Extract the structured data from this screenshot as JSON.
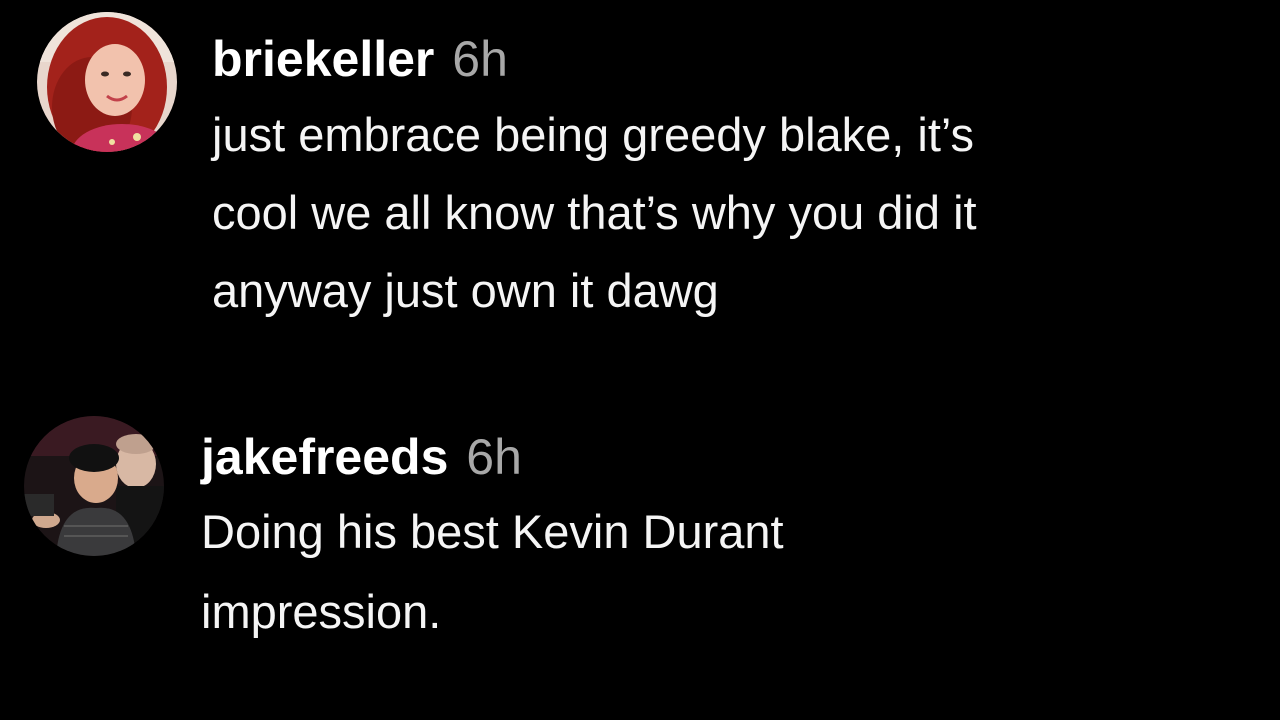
{
  "comments": [
    {
      "username": "briekeller",
      "timestamp": "6h",
      "text": "just embrace being greedy blake, it’s\ncool we all know that’s why you did it\nanyway just own it dawg",
      "avatar": "avatar-photo-red-hair"
    },
    {
      "username": "jakefreeds",
      "timestamp": "6h",
      "text": "Doing his best Kevin Durant\nimpression.",
      "avatar": "avatar-photo-two-people"
    }
  ],
  "colors": {
    "background": "#000000",
    "username": "#ffffff",
    "timestamp": "#a8a8a8",
    "text": "#f5f5f5"
  }
}
